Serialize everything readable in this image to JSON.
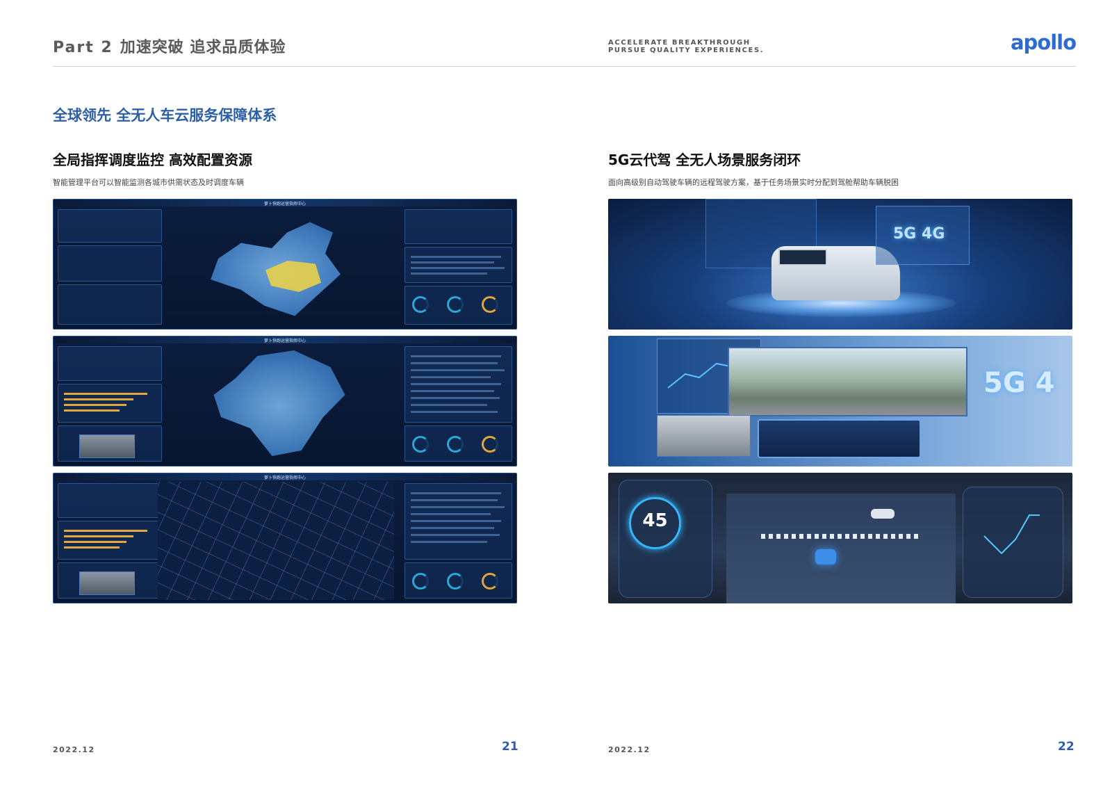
{
  "header": {
    "part_label": "Part 2",
    "part_title": "加速突破 追求品质体验",
    "english_line1": "ACCELERATE BREAKTHROUGH",
    "english_line2": "PURSUE QUALITY EXPERIENCES.",
    "logo": "apollo"
  },
  "section_title": "全球领先 全无人车云服务保障体系",
  "left_column": {
    "title": "全局指挥调度监控 高效配置资源",
    "description": "智能管理平台可以智能监测各城市供需状态及时调度车辆",
    "screenshots": [
      {
        "banner": "萝卜快跑运营指挥中心"
      },
      {
        "banner": "萝卜快跑运营指挥中心"
      },
      {
        "banner": "萝卜快跑运营指挥中心"
      }
    ]
  },
  "right_column": {
    "title": "5G云代驾 全无人场景服务闭环",
    "description": "面向高级别自动驾驶车辆的远程驾驶方案，基于任务场景实时分配到驾舱帮助车辆脱困",
    "scene1_text": "5G 4G",
    "scene2_text": "5G 4",
    "scene3_speed": "45"
  },
  "footer": {
    "left_date": "2022.12",
    "left_page": "21",
    "right_date": "2022.12",
    "right_page": "22"
  },
  "colors": {
    "accent_blue": "#2d5fa6",
    "logo_blue": "#2d6ad6",
    "dashboard_bg": "#0b1d3d"
  }
}
